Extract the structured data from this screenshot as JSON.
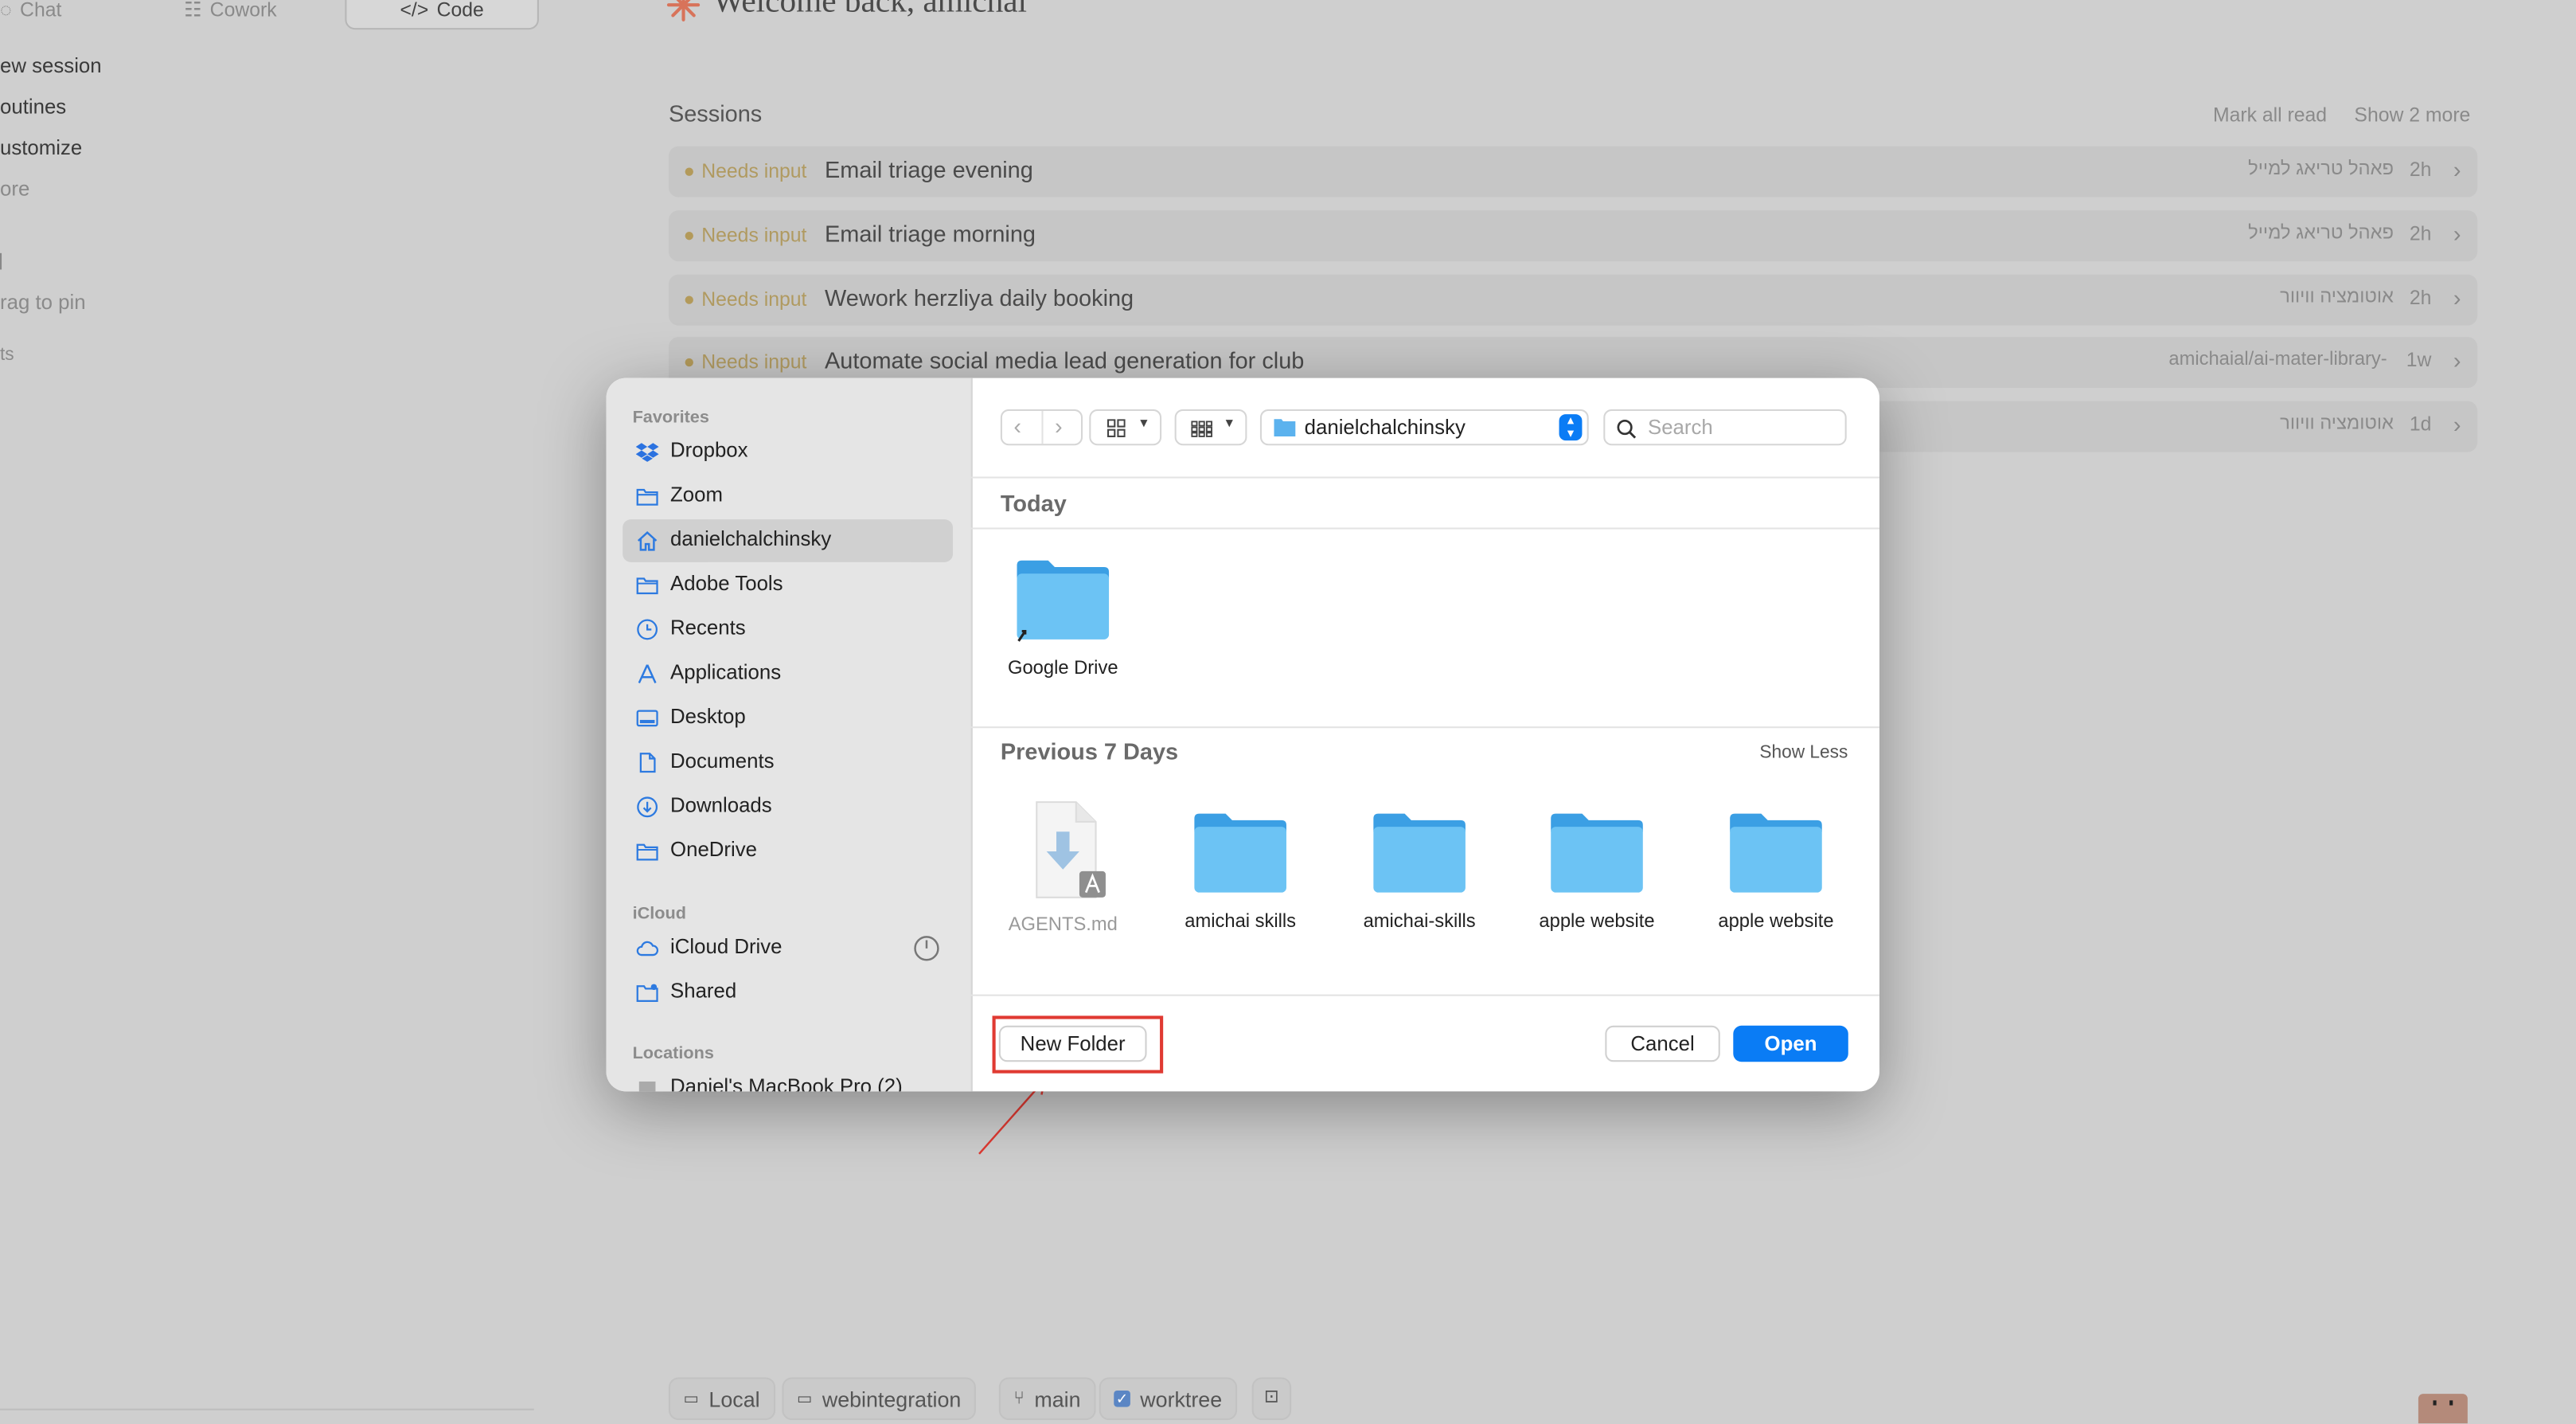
{
  "tabs": [
    {
      "label": "Chat"
    },
    {
      "label": "Cowork"
    },
    {
      "label": "Code"
    }
  ],
  "sidebar": {
    "items": [
      {
        "label": "ew session"
      },
      {
        "label": "outines"
      },
      {
        "label": "ustomize"
      },
      {
        "label": "ore"
      }
    ],
    "pin_hint": "rag to pin",
    "footer": "ts"
  },
  "welcome": "Welcome back, amichai",
  "sessions": {
    "heading": "Sessions",
    "mark_all_read": "Mark all read",
    "show_more": "Show 2 more",
    "rows": [
      {
        "status": "Needs input",
        "title": "Email triage evening",
        "meta": "פאהל טריאג למייל",
        "age": "2h"
      },
      {
        "status": "Needs input",
        "title": "Email triage morning",
        "meta": "פאהל טריאג למייל",
        "age": "2h"
      },
      {
        "status": "Needs input",
        "title": "Wework herzliya daily booking",
        "meta": "אוטומציה וויוור",
        "age": "2h"
      },
      {
        "status": "Needs input",
        "title": "Automate social media lead generation for club",
        "meta": "amichaial/ai-mater-library-",
        "age": "1w"
      },
      {
        "status": "",
        "title": "",
        "meta": "אוטומציה וויוור",
        "age": "1d"
      }
    ]
  },
  "bottom_bar": {
    "local": "Local",
    "repo": "webintegration",
    "branch": "main",
    "worktree": "worktree"
  },
  "dialog": {
    "sidebar": {
      "favorites_heading": "Favorites",
      "favorites": [
        {
          "label": "Dropbox",
          "icon": "dropbox-icon"
        },
        {
          "label": "Zoom",
          "icon": "folder-icon"
        },
        {
          "label": "danielchalchinsky",
          "icon": "home-icon"
        },
        {
          "label": "Adobe Tools",
          "icon": "folder-icon"
        },
        {
          "label": "Recents",
          "icon": "clock-icon"
        },
        {
          "label": "Applications",
          "icon": "applications-icon"
        },
        {
          "label": "Desktop",
          "icon": "desktop-icon"
        },
        {
          "label": "Documents",
          "icon": "document-icon"
        },
        {
          "label": "Downloads",
          "icon": "download-icon"
        },
        {
          "label": "OneDrive",
          "icon": "folder-icon"
        }
      ],
      "icloud_heading": "iCloud",
      "icloud": [
        {
          "label": "iCloud Drive",
          "icon": "cloud-icon"
        },
        {
          "label": "Shared",
          "icon": "shared-folder-icon"
        }
      ],
      "locations_heading": "Locations",
      "locations": [
        {
          "label": "Daniel's MacBook Pro (2)",
          "icon": "laptop-icon"
        }
      ]
    },
    "toolbar": {
      "location": "danielchalchinsky",
      "search_placeholder": "Search"
    },
    "groups": {
      "today": "Today",
      "previous": "Previous 7 Days",
      "show_less": "Show Less"
    },
    "today_files": [
      {
        "name": "Google Drive",
        "type": "folder-alias"
      }
    ],
    "previous_files": [
      {
        "name": "AGENTS.md",
        "type": "file"
      },
      {
        "name": "amichai skills",
        "type": "folder"
      },
      {
        "name": "amichai-skills",
        "type": "folder"
      },
      {
        "name": "apple website",
        "type": "folder"
      },
      {
        "name": "apple website",
        "type": "folder"
      }
    ],
    "buttons": {
      "new_folder": "New Folder",
      "cancel": "Cancel",
      "open": "Open"
    }
  },
  "colors": {
    "accent": "#0a7cf5",
    "annotation": "#e03a32",
    "folder": "#5bbcf2"
  }
}
